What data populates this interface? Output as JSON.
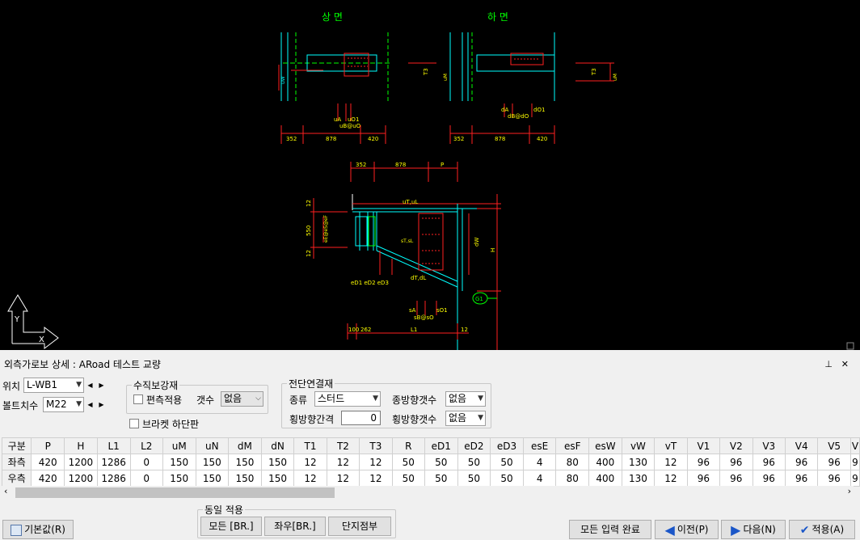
{
  "drawing": {
    "top_title": "상  면",
    "bottom_title": "하  면",
    "dims_a": [
      "352",
      "878",
      "420"
    ],
    "dims_b": [
      "352",
      "878",
      "420"
    ],
    "dims_main": [
      "352",
      "878",
      "P"
    ],
    "labels": {
      "uA": "uA",
      "uO1": "uO1",
      "uB": "uB@uO",
      "dA": "dA",
      "dO1": "dO1",
      "dB": "dB@dO",
      "uTuL": "uT,uL",
      "dTdL": "dT,dL",
      "eD": "eD1 eD2 eD3",
      "sA": "sA",
      "sO1": "sO1",
      "sB": "sB@sO",
      "n550": "550",
      "n12a": "12",
      "n12b": "12",
      "n12c": "12",
      "H": "H",
      "dW": "dW",
      "L1": "L1",
      "n100": "100",
      "n262": "262",
      "g1": "G1",
      "T3a": "T3",
      "T3b": "T3",
      "uW": "uW",
      "uM": "uM",
      "sW": "sW",
      "sTsL": "sT,sL",
      "eEeSeF": "eE@eS"
    },
    "axis_y": "Y",
    "axis_x": "X"
  },
  "panel": {
    "title": "외측가로보 상세 : ARoad 테스트 교량",
    "pin": "ㅍ",
    "close": "✕"
  },
  "form": {
    "position_label": "위치",
    "position_value": "L-WB1",
    "bolt_label": "볼트치수",
    "bolt_value": "M22",
    "vertical_group": "수직보강재",
    "one_side_label": "편측적용",
    "count_label": "갯수",
    "count_value": "없음",
    "bracket_label": "브라켓 하단판",
    "shear_group": "전단연결재",
    "type_label": "종류",
    "type_value": "스터드",
    "long_count_label": "종방향갯수",
    "long_count_value": "없음",
    "trans_spacing_label": "횡방향간격",
    "trans_spacing_value": "0",
    "trans_count_label": "횡방향갯수",
    "trans_count_value": "없음"
  },
  "table": {
    "columns": [
      "구분",
      "P",
      "H",
      "L1",
      "L2",
      "uM",
      "uN",
      "dM",
      "dN",
      "T1",
      "T2",
      "T3",
      "R",
      "eD1",
      "eD2",
      "eD3",
      "esE",
      "esF",
      "esW",
      "vW",
      "vT",
      "V1",
      "V2",
      "V3",
      "V4",
      "V5",
      "V"
    ],
    "rows": [
      {
        "name": "좌측",
        "values": [
          "420",
          "1200",
          "1286",
          "0",
          "150",
          "150",
          "150",
          "150",
          "12",
          "12",
          "12",
          "50",
          "50",
          "50",
          "50",
          "4",
          "80",
          "400",
          "130",
          "12",
          "96",
          "96",
          "96",
          "96",
          "96",
          "9"
        ]
      },
      {
        "name": "우측",
        "values": [
          "420",
          "1200",
          "1286",
          "0",
          "150",
          "150",
          "150",
          "150",
          "12",
          "12",
          "12",
          "50",
          "50",
          "50",
          "50",
          "4",
          "80",
          "400",
          "130",
          "12",
          "96",
          "96",
          "96",
          "96",
          "96",
          "9"
        ]
      }
    ]
  },
  "same_apply": {
    "title": "동일 적용",
    "all": "모든 [BR.]",
    "lr": "좌우[BR.]",
    "end": "단지점부"
  },
  "buttons": {
    "default": "기본값(R)",
    "all_done": "모든 입력 완료",
    "prev": "이전(P)",
    "next": "다음(N)",
    "apply": "적용(A)"
  },
  "colors": {
    "cad_bg": "#000000",
    "red": "#ff2020",
    "cyan": "#00ffff",
    "green": "#00ff00",
    "yellow": "#ffff00",
    "white": "#ffffff"
  }
}
